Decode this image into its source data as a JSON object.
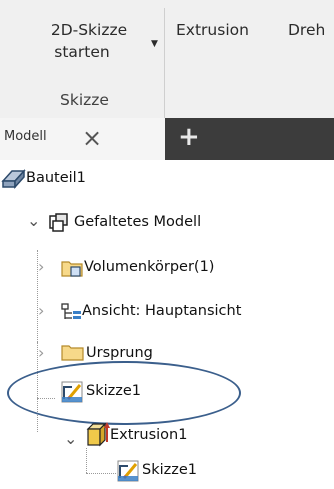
{
  "ribbon": {
    "sketch_button_line1": "2D-Skizze",
    "sketch_button_line2": "starten",
    "extrude_label": "Extrusion",
    "rotate_label": "Dreh",
    "group_label": "Skizze"
  },
  "browser_tabs": {
    "model_label": "Modell",
    "close_symbol": "×",
    "add_symbol": "+"
  },
  "tree": {
    "part": "Bauteil1",
    "folded_model": "Gefaltetes Modell",
    "solid_bodies": "Volumenkörper(1)",
    "view": "Ansicht: Hauptansicht",
    "origin": "Ursprung",
    "sketch1": "Skizze1",
    "extrusion": "Extrusion1",
    "extrusion_sketch": "Skizze1"
  },
  "colors": {
    "ribbon_bg": "#f0f0f0",
    "tabbar_bg": "#3c3c3c",
    "highlight_ellipse": "#3b5f8c"
  }
}
